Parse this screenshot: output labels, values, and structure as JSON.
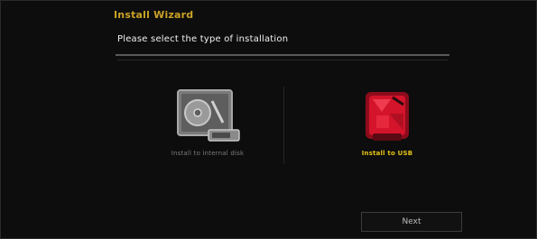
{
  "wizard": {
    "title": "Install Wizard",
    "subtitle": "Please select the type of installation",
    "options": [
      {
        "label": "Install to internal disk",
        "icon": "hard-disk-icon",
        "selected": false
      },
      {
        "label": "Install to USB",
        "icon": "usb-drive-icon",
        "selected": true
      }
    ],
    "next_label": "Next"
  },
  "colors": {
    "title": "#c9a227",
    "selected_label": "#e4c417",
    "selected_icon": "#d4142a",
    "background": "#0d0d0d"
  }
}
